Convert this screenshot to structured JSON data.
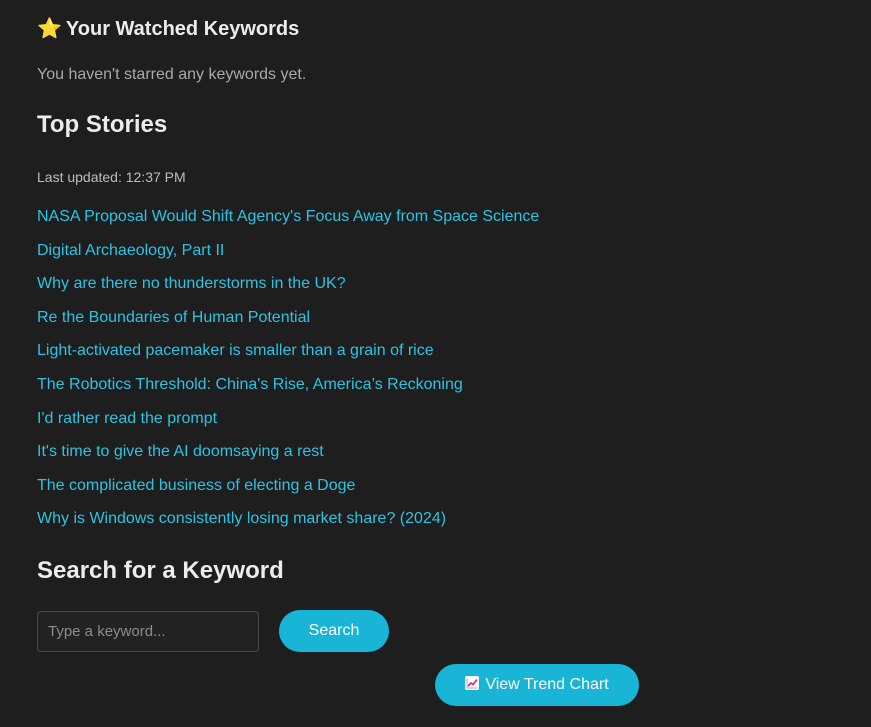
{
  "watched": {
    "icon": "star-icon",
    "star_glyph": "⭐",
    "heading": "Your Watched Keywords",
    "empty_message": "You haven't starred any keywords yet."
  },
  "top_stories": {
    "title": "Top Stories",
    "last_updated": "Last updated: 12:37 PM",
    "link_color": "#2cc4e2",
    "items": [
      "NASA Proposal Would Shift Agency's Focus Away from Space Science",
      "Digital Archaeology, Part II",
      "Why are there no thunderstorms in the UK?",
      "Re the Boundaries of Human Potential",
      "Light-activated pacemaker is smaller than a grain of rice",
      "The Robotics Threshold: China's Rise, America’s Reckoning",
      "I'd rather read the prompt",
      "It's time to give the AI doomsaying a rest",
      "The complicated business of electing a Doge",
      "Why is Windows consistently losing market share? (2024)"
    ]
  },
  "search": {
    "title": "Search for a Keyword",
    "placeholder": "Type a keyword...",
    "value": "",
    "button_label": "Search",
    "button_color": "#18b5d6"
  },
  "trend": {
    "icon": "chart-increasing-icon",
    "button_label": "View Trend Chart"
  }
}
